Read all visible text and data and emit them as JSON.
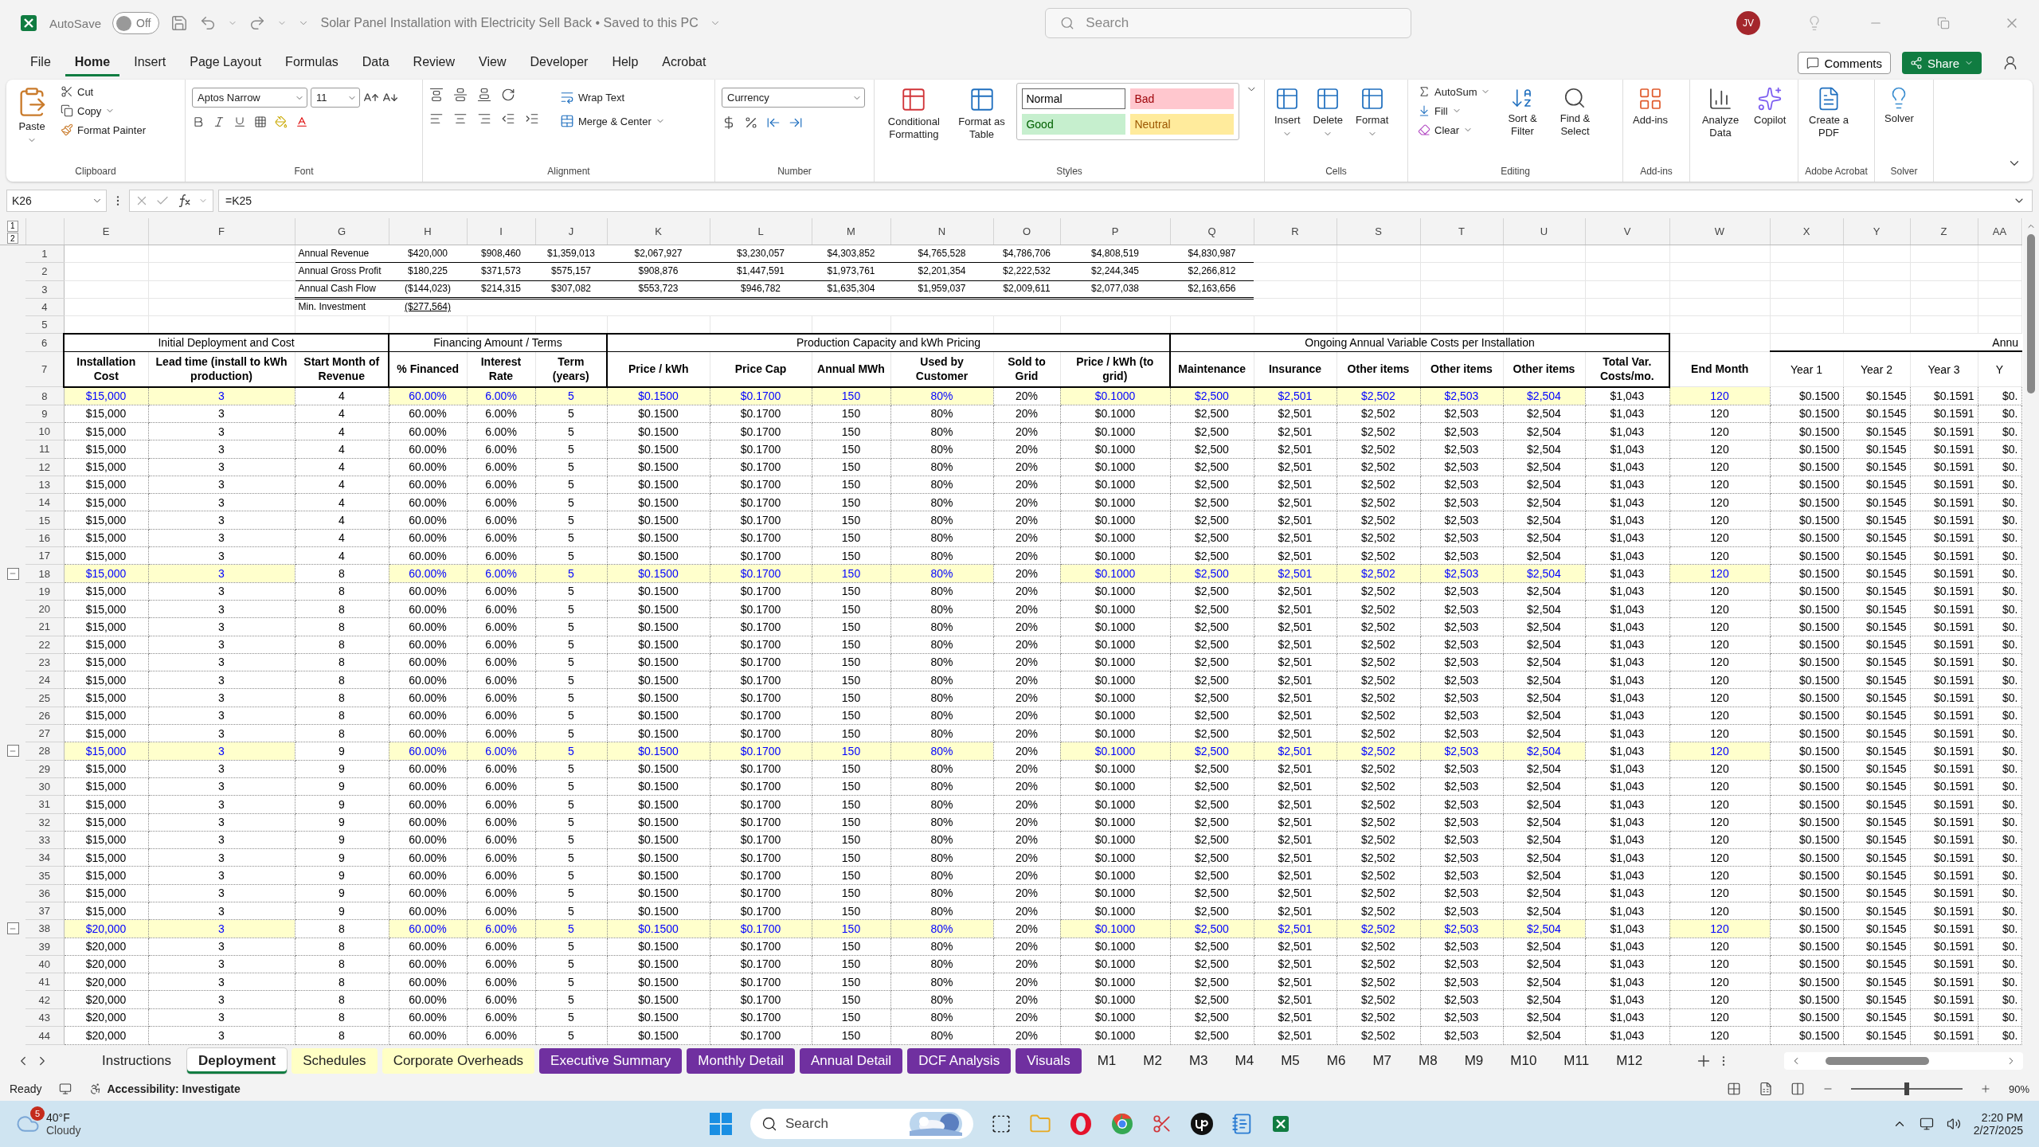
{
  "title_bar": {
    "autosave_label": "AutoSave",
    "autosave_state": "Off",
    "autosave_on": false,
    "document_title": "Solar Panel Installation with Electricity Sell Back • Saved to this PC",
    "search_placeholder": "Search",
    "avatar": "JV"
  },
  "menu_tabs": [
    {
      "label": "File",
      "selected": false
    },
    {
      "label": "Home",
      "selected": true
    },
    {
      "label": "Insert",
      "selected": false
    },
    {
      "label": "Page Layout",
      "selected": false
    },
    {
      "label": "Formulas",
      "selected": false
    },
    {
      "label": "Data",
      "selected": false
    },
    {
      "label": "Review",
      "selected": false
    },
    {
      "label": "View",
      "selected": false
    },
    {
      "label": "Developer",
      "selected": false
    },
    {
      "label": "Help",
      "selected": false
    },
    {
      "label": "Acrobat",
      "selected": false
    }
  ],
  "header_buttons": {
    "comments": "Comments",
    "share": "Share"
  },
  "ribbon": {
    "clipboard": {
      "label": "Clipboard",
      "paste": "Paste",
      "cut": "Cut",
      "copy": "Copy",
      "format_painter": "Format Painter"
    },
    "font": {
      "label": "Font",
      "name": "Aptos Narrow",
      "size": "11"
    },
    "alignment": {
      "label": "Alignment",
      "wrap": "Wrap Text",
      "merge": "Merge & Center"
    },
    "number": {
      "label": "Number",
      "format": "Currency"
    },
    "styles": {
      "label": "Styles",
      "conditional": "Conditional Formatting",
      "table": "Format as Table",
      "gallery": [
        {
          "label": "Normal",
          "color": "#ffffff"
        },
        {
          "label": "Bad",
          "color": "#ffc7ce"
        },
        {
          "label": "Good",
          "color": "#c6efce"
        },
        {
          "label": "Neutral",
          "color": "#ffeb9c"
        }
      ]
    },
    "cells": {
      "label": "Cells",
      "buttons": [
        "Insert",
        "Delete",
        "Format"
      ]
    },
    "editing": {
      "label": "Editing",
      "autosum": "AutoSum",
      "fill": "Fill",
      "clear": "Clear",
      "sort": "Sort & Filter",
      "find": "Find & Select"
    },
    "addins": {
      "label": "Add-ins",
      "button": "Add-ins"
    },
    "analysis": {
      "analyze": "Analyze Data",
      "copilot": "Copilot"
    },
    "acrobat": {
      "label": "Adobe Acrobat",
      "button": "Create a PDF"
    },
    "solver": {
      "label": "Solver",
      "button": "Solver"
    }
  },
  "formula_bar": {
    "name_box": "K26",
    "formula": "=K25"
  },
  "outline_levels": [
    "1",
    "2"
  ],
  "columns": [
    {
      "letter": "E",
      "header": "Installation Cost",
      "input": true,
      "kind": "main"
    },
    {
      "letter": "F",
      "header": "Lead time (install to kWh production)",
      "input": true,
      "kind": "main"
    },
    {
      "letter": "G",
      "header": "Start Month of Revenue",
      "input": false,
      "kind": "main"
    },
    {
      "letter": "H",
      "header": "% Financed",
      "input": true,
      "kind": "main"
    },
    {
      "letter": "I",
      "header": "Interest Rate",
      "input": true,
      "kind": "main"
    },
    {
      "letter": "J",
      "header": "Term (years)",
      "input": true,
      "kind": "main"
    },
    {
      "letter": "K",
      "header": "Price / kWh",
      "input": true,
      "kind": "main"
    },
    {
      "letter": "L",
      "header": "Price Cap",
      "input": true,
      "kind": "main"
    },
    {
      "letter": "M",
      "header": "Annual MWh",
      "input": true,
      "kind": "main"
    },
    {
      "letter": "N",
      "header": "Used by Customer",
      "input": true,
      "kind": "main"
    },
    {
      "letter": "O",
      "header": "Sold to Grid",
      "input": false,
      "kind": "main"
    },
    {
      "letter": "P",
      "header": "Price / kWh (to grid)",
      "input": true,
      "kind": "main"
    },
    {
      "letter": "Q",
      "header": "Maintenance",
      "input": true,
      "kind": "main"
    },
    {
      "letter": "R",
      "header": "Insurance",
      "input": true,
      "kind": "main"
    },
    {
      "letter": "S",
      "header": "Other items",
      "input": true,
      "kind": "main"
    },
    {
      "letter": "T",
      "header": "Other items",
      "input": true,
      "kind": "main"
    },
    {
      "letter": "U",
      "header": "Other items",
      "input": true,
      "kind": "main"
    },
    {
      "letter": "V",
      "header": "Total Var. Costs/mo.",
      "input": false,
      "kind": "main"
    },
    {
      "letter": "W",
      "header": "End Month",
      "input": true,
      "kind": "end"
    },
    {
      "letter": "X",
      "header": "Year 1",
      "input": false,
      "kind": "yearly"
    },
    {
      "letter": "Y",
      "header": "Year 2",
      "input": false,
      "kind": "yearly"
    },
    {
      "letter": "Z",
      "header": "Year 3",
      "input": false,
      "kind": "yearly"
    },
    {
      "letter": "AA",
      "header": "Y",
      "input": false,
      "kind": "yearly"
    }
  ],
  "summary_rows": [
    {
      "row": "1",
      "kind": "rule",
      "label": "Annual Revenue",
      "values": [
        "$420,000",
        "$908,460",
        "$1,359,013",
        "$2,067,927",
        "$3,230,057",
        "$4,303,852",
        "$4,765,528",
        "$4,786,706",
        "$4,808,519",
        "$4,830,987"
      ]
    },
    {
      "row": "2",
      "kind": "rule",
      "label": "Annual Gross Profit",
      "values": [
        "$180,225",
        "$371,573",
        "$575,157",
        "$908,876",
        "$1,447,591",
        "$1,973,761",
        "$2,201,354",
        "$2,222,532",
        "$2,244,345",
        "$2,266,812"
      ]
    },
    {
      "row": "3",
      "kind": "double-rule",
      "label": "Annual Cash Flow",
      "values": [
        "($144,023)",
        "$214,315",
        "$307,082",
        "$553,723",
        "$946,782",
        "$1,635,304",
        "$1,959,037",
        "$2,009,611",
        "$2,077,038",
        "$2,163,656"
      ]
    },
    {
      "row": "4",
      "kind": "underlined-value",
      "label": "Min. Investment",
      "values": [
        "($277,564)"
      ]
    }
  ],
  "blank_rows": [
    "5"
  ],
  "section_row": "6",
  "sections": [
    {
      "label": "Initial Deployment and Cost",
      "kind": "boxed"
    },
    {
      "label": "Financing Amount / Terms",
      "kind": "boxed"
    },
    {
      "label": "Production Capacity and kWh Pricing",
      "kind": "boxed"
    },
    {
      "label": "Ongoing Annual Variable Costs per Installation",
      "kind": "boxed"
    },
    {
      "label": "Annu",
      "kind": "open"
    }
  ],
  "header_row": "7",
  "rows": [
    {
      "row": "8",
      "kind": "input",
      "collapse_button": false,
      "cells": [
        "$15,000",
        "3",
        "4",
        "60.00%",
        "6.00%",
        "5",
        "$0.1500",
        "$0.1700",
        "150",
        "80%",
        "20%",
        "$0.1000",
        "$2,500",
        "$2,501",
        "$2,502",
        "$2,503",
        "$2,504",
        "$1,043",
        "120",
        "$0.1500",
        "$0.1545",
        "$0.1591",
        "$0."
      ]
    },
    {
      "row": "9",
      "kind": "formula",
      "collapse_button": false,
      "cells": [
        "$15,000",
        "3",
        "4",
        "60.00%",
        "6.00%",
        "5",
        "$0.1500",
        "$0.1700",
        "150",
        "80%",
        "20%",
        "$0.1000",
        "$2,500",
        "$2,501",
        "$2,502",
        "$2,503",
        "$2,504",
        "$1,043",
        "120",
        "$0.1500",
        "$0.1545",
        "$0.1591",
        "$0."
      ]
    },
    {
      "row": "10",
      "kind": "formula",
      "collapse_button": false,
      "cells": [
        "$15,000",
        "3",
        "4",
        "60.00%",
        "6.00%",
        "5",
        "$0.1500",
        "$0.1700",
        "150",
        "80%",
        "20%",
        "$0.1000",
        "$2,500",
        "$2,501",
        "$2,502",
        "$2,503",
        "$2,504",
        "$1,043",
        "120",
        "$0.1500",
        "$0.1545",
        "$0.1591",
        "$0."
      ]
    },
    {
      "row": "11",
      "kind": "formula",
      "collapse_button": false,
      "cells": [
        "$15,000",
        "3",
        "4",
        "60.00%",
        "6.00%",
        "5",
        "$0.1500",
        "$0.1700",
        "150",
        "80%",
        "20%",
        "$0.1000",
        "$2,500",
        "$2,501",
        "$2,502",
        "$2,503",
        "$2,504",
        "$1,043",
        "120",
        "$0.1500",
        "$0.1545",
        "$0.1591",
        "$0."
      ]
    },
    {
      "row": "12",
      "kind": "formula",
      "collapse_button": false,
      "cells": [
        "$15,000",
        "3",
        "4",
        "60.00%",
        "6.00%",
        "5",
        "$0.1500",
        "$0.1700",
        "150",
        "80%",
        "20%",
        "$0.1000",
        "$2,500",
        "$2,501",
        "$2,502",
        "$2,503",
        "$2,504",
        "$1,043",
        "120",
        "$0.1500",
        "$0.1545",
        "$0.1591",
        "$0."
      ]
    },
    {
      "row": "13",
      "kind": "formula",
      "collapse_button": false,
      "cells": [
        "$15,000",
        "3",
        "4",
        "60.00%",
        "6.00%",
        "5",
        "$0.1500",
        "$0.1700",
        "150",
        "80%",
        "20%",
        "$0.1000",
        "$2,500",
        "$2,501",
        "$2,502",
        "$2,503",
        "$2,504",
        "$1,043",
        "120",
        "$0.1500",
        "$0.1545",
        "$0.1591",
        "$0."
      ]
    },
    {
      "row": "14",
      "kind": "formula",
      "collapse_button": false,
      "cells": [
        "$15,000",
        "3",
        "4",
        "60.00%",
        "6.00%",
        "5",
        "$0.1500",
        "$0.1700",
        "150",
        "80%",
        "20%",
        "$0.1000",
        "$2,500",
        "$2,501",
        "$2,502",
        "$2,503",
        "$2,504",
        "$1,043",
        "120",
        "$0.1500",
        "$0.1545",
        "$0.1591",
        "$0."
      ]
    },
    {
      "row": "15",
      "kind": "formula",
      "collapse_button": false,
      "cells": [
        "$15,000",
        "3",
        "4",
        "60.00%",
        "6.00%",
        "5",
        "$0.1500",
        "$0.1700",
        "150",
        "80%",
        "20%",
        "$0.1000",
        "$2,500",
        "$2,501",
        "$2,502",
        "$2,503",
        "$2,504",
        "$1,043",
        "120",
        "$0.1500",
        "$0.1545",
        "$0.1591",
        "$0."
      ]
    },
    {
      "row": "16",
      "kind": "formula",
      "collapse_button": false,
      "cells": [
        "$15,000",
        "3",
        "4",
        "60.00%",
        "6.00%",
        "5",
        "$0.1500",
        "$0.1700",
        "150",
        "80%",
        "20%",
        "$0.1000",
        "$2,500",
        "$2,501",
        "$2,502",
        "$2,503",
        "$2,504",
        "$1,043",
        "120",
        "$0.1500",
        "$0.1545",
        "$0.1591",
        "$0."
      ]
    },
    {
      "row": "17",
      "kind": "formula",
      "collapse_button": false,
      "cells": [
        "$15,000",
        "3",
        "4",
        "60.00%",
        "6.00%",
        "5",
        "$0.1500",
        "$0.1700",
        "150",
        "80%",
        "20%",
        "$0.1000",
        "$2,500",
        "$2,501",
        "$2,502",
        "$2,503",
        "$2,504",
        "$1,043",
        "120",
        "$0.1500",
        "$0.1545",
        "$0.1591",
        "$0."
      ]
    },
    {
      "row": "18",
      "kind": "input",
      "collapse_button": true,
      "cells": [
        "$15,000",
        "3",
        "8",
        "60.00%",
        "6.00%",
        "5",
        "$0.1500",
        "$0.1700",
        "150",
        "80%",
        "20%",
        "$0.1000",
        "$2,500",
        "$2,501",
        "$2,502",
        "$2,503",
        "$2,504",
        "$1,043",
        "120",
        "$0.1500",
        "$0.1545",
        "$0.1591",
        "$0."
      ]
    },
    {
      "row": "19",
      "kind": "formula",
      "collapse_button": false,
      "cells": [
        "$15,000",
        "3",
        "8",
        "60.00%",
        "6.00%",
        "5",
        "$0.1500",
        "$0.1700",
        "150",
        "80%",
        "20%",
        "$0.1000",
        "$2,500",
        "$2,501",
        "$2,502",
        "$2,503",
        "$2,504",
        "$1,043",
        "120",
        "$0.1500",
        "$0.1545",
        "$0.1591",
        "$0."
      ]
    },
    {
      "row": "20",
      "kind": "formula",
      "collapse_button": false,
      "cells": [
        "$15,000",
        "3",
        "8",
        "60.00%",
        "6.00%",
        "5",
        "$0.1500",
        "$0.1700",
        "150",
        "80%",
        "20%",
        "$0.1000",
        "$2,500",
        "$2,501",
        "$2,502",
        "$2,503",
        "$2,504",
        "$1,043",
        "120",
        "$0.1500",
        "$0.1545",
        "$0.1591",
        "$0."
      ]
    },
    {
      "row": "21",
      "kind": "formula",
      "collapse_button": false,
      "cells": [
        "$15,000",
        "3",
        "8",
        "60.00%",
        "6.00%",
        "5",
        "$0.1500",
        "$0.1700",
        "150",
        "80%",
        "20%",
        "$0.1000",
        "$2,500",
        "$2,501",
        "$2,502",
        "$2,503",
        "$2,504",
        "$1,043",
        "120",
        "$0.1500",
        "$0.1545",
        "$0.1591",
        "$0."
      ]
    },
    {
      "row": "22",
      "kind": "formula",
      "collapse_button": false,
      "cells": [
        "$15,000",
        "3",
        "8",
        "60.00%",
        "6.00%",
        "5",
        "$0.1500",
        "$0.1700",
        "150",
        "80%",
        "20%",
        "$0.1000",
        "$2,500",
        "$2,501",
        "$2,502",
        "$2,503",
        "$2,504",
        "$1,043",
        "120",
        "$0.1500",
        "$0.1545",
        "$0.1591",
        "$0."
      ]
    },
    {
      "row": "23",
      "kind": "formula",
      "collapse_button": false,
      "cells": [
        "$15,000",
        "3",
        "8",
        "60.00%",
        "6.00%",
        "5",
        "$0.1500",
        "$0.1700",
        "150",
        "80%",
        "20%",
        "$0.1000",
        "$2,500",
        "$2,501",
        "$2,502",
        "$2,503",
        "$2,504",
        "$1,043",
        "120",
        "$0.1500",
        "$0.1545",
        "$0.1591",
        "$0."
      ]
    },
    {
      "row": "24",
      "kind": "formula",
      "collapse_button": false,
      "cells": [
        "$15,000",
        "3",
        "8",
        "60.00%",
        "6.00%",
        "5",
        "$0.1500",
        "$0.1700",
        "150",
        "80%",
        "20%",
        "$0.1000",
        "$2,500",
        "$2,501",
        "$2,502",
        "$2,503",
        "$2,504",
        "$1,043",
        "120",
        "$0.1500",
        "$0.1545",
        "$0.1591",
        "$0."
      ]
    },
    {
      "row": "25",
      "kind": "formula",
      "collapse_button": false,
      "cells": [
        "$15,000",
        "3",
        "8",
        "60.00%",
        "6.00%",
        "5",
        "$0.1500",
        "$0.1700",
        "150",
        "80%",
        "20%",
        "$0.1000",
        "$2,500",
        "$2,501",
        "$2,502",
        "$2,503",
        "$2,504",
        "$1,043",
        "120",
        "$0.1500",
        "$0.1545",
        "$0.1591",
        "$0."
      ]
    },
    {
      "row": "26",
      "kind": "formula",
      "collapse_button": false,
      "cells": [
        "$15,000",
        "3",
        "8",
        "60.00%",
        "6.00%",
        "5",
        "$0.1500",
        "$0.1700",
        "150",
        "80%",
        "20%",
        "$0.1000",
        "$2,500",
        "$2,501",
        "$2,502",
        "$2,503",
        "$2,504",
        "$1,043",
        "120",
        "$0.1500",
        "$0.1545",
        "$0.1591",
        "$0."
      ]
    },
    {
      "row": "27",
      "kind": "formula",
      "collapse_button": false,
      "cells": [
        "$15,000",
        "3",
        "8",
        "60.00%",
        "6.00%",
        "5",
        "$0.1500",
        "$0.1700",
        "150",
        "80%",
        "20%",
        "$0.1000",
        "$2,500",
        "$2,501",
        "$2,502",
        "$2,503",
        "$2,504",
        "$1,043",
        "120",
        "$0.1500",
        "$0.1545",
        "$0.1591",
        "$0."
      ]
    },
    {
      "row": "28",
      "kind": "input",
      "collapse_button": true,
      "cells": [
        "$15,000",
        "3",
        "9",
        "60.00%",
        "6.00%",
        "5",
        "$0.1500",
        "$0.1700",
        "150",
        "80%",
        "20%",
        "$0.1000",
        "$2,500",
        "$2,501",
        "$2,502",
        "$2,503",
        "$2,504",
        "$1,043",
        "120",
        "$0.1500",
        "$0.1545",
        "$0.1591",
        "$0."
      ]
    },
    {
      "row": "29",
      "kind": "formula",
      "collapse_button": false,
      "cells": [
        "$15,000",
        "3",
        "9",
        "60.00%",
        "6.00%",
        "5",
        "$0.1500",
        "$0.1700",
        "150",
        "80%",
        "20%",
        "$0.1000",
        "$2,500",
        "$2,501",
        "$2,502",
        "$2,503",
        "$2,504",
        "$1,043",
        "120",
        "$0.1500",
        "$0.1545",
        "$0.1591",
        "$0."
      ]
    },
    {
      "row": "30",
      "kind": "formula",
      "collapse_button": false,
      "cells": [
        "$15,000",
        "3",
        "9",
        "60.00%",
        "6.00%",
        "5",
        "$0.1500",
        "$0.1700",
        "150",
        "80%",
        "20%",
        "$0.1000",
        "$2,500",
        "$2,501",
        "$2,502",
        "$2,503",
        "$2,504",
        "$1,043",
        "120",
        "$0.1500",
        "$0.1545",
        "$0.1591",
        "$0."
      ]
    },
    {
      "row": "31",
      "kind": "formula",
      "collapse_button": false,
      "cells": [
        "$15,000",
        "3",
        "9",
        "60.00%",
        "6.00%",
        "5",
        "$0.1500",
        "$0.1700",
        "150",
        "80%",
        "20%",
        "$0.1000",
        "$2,500",
        "$2,501",
        "$2,502",
        "$2,503",
        "$2,504",
        "$1,043",
        "120",
        "$0.1500",
        "$0.1545",
        "$0.1591",
        "$0."
      ]
    },
    {
      "row": "32",
      "kind": "formula",
      "collapse_button": false,
      "cells": [
        "$15,000",
        "3",
        "9",
        "60.00%",
        "6.00%",
        "5",
        "$0.1500",
        "$0.1700",
        "150",
        "80%",
        "20%",
        "$0.1000",
        "$2,500",
        "$2,501",
        "$2,502",
        "$2,503",
        "$2,504",
        "$1,043",
        "120",
        "$0.1500",
        "$0.1545",
        "$0.1591",
        "$0."
      ]
    },
    {
      "row": "33",
      "kind": "formula",
      "collapse_button": false,
      "cells": [
        "$15,000",
        "3",
        "9",
        "60.00%",
        "6.00%",
        "5",
        "$0.1500",
        "$0.1700",
        "150",
        "80%",
        "20%",
        "$0.1000",
        "$2,500",
        "$2,501",
        "$2,502",
        "$2,503",
        "$2,504",
        "$1,043",
        "120",
        "$0.1500",
        "$0.1545",
        "$0.1591",
        "$0."
      ]
    },
    {
      "row": "34",
      "kind": "formula",
      "collapse_button": false,
      "cells": [
        "$15,000",
        "3",
        "9",
        "60.00%",
        "6.00%",
        "5",
        "$0.1500",
        "$0.1700",
        "150",
        "80%",
        "20%",
        "$0.1000",
        "$2,500",
        "$2,501",
        "$2,502",
        "$2,503",
        "$2,504",
        "$1,043",
        "120",
        "$0.1500",
        "$0.1545",
        "$0.1591",
        "$0."
      ]
    },
    {
      "row": "35",
      "kind": "formula",
      "collapse_button": false,
      "cells": [
        "$15,000",
        "3",
        "9",
        "60.00%",
        "6.00%",
        "5",
        "$0.1500",
        "$0.1700",
        "150",
        "80%",
        "20%",
        "$0.1000",
        "$2,500",
        "$2,501",
        "$2,502",
        "$2,503",
        "$2,504",
        "$1,043",
        "120",
        "$0.1500",
        "$0.1545",
        "$0.1591",
        "$0."
      ]
    },
    {
      "row": "36",
      "kind": "formula",
      "collapse_button": false,
      "cells": [
        "$15,000",
        "3",
        "9",
        "60.00%",
        "6.00%",
        "5",
        "$0.1500",
        "$0.1700",
        "150",
        "80%",
        "20%",
        "$0.1000",
        "$2,500",
        "$2,501",
        "$2,502",
        "$2,503",
        "$2,504",
        "$1,043",
        "120",
        "$0.1500",
        "$0.1545",
        "$0.1591",
        "$0."
      ]
    },
    {
      "row": "37",
      "kind": "formula",
      "collapse_button": false,
      "cells": [
        "$15,000",
        "3",
        "9",
        "60.00%",
        "6.00%",
        "5",
        "$0.1500",
        "$0.1700",
        "150",
        "80%",
        "20%",
        "$0.1000",
        "$2,500",
        "$2,501",
        "$2,502",
        "$2,503",
        "$2,504",
        "$1,043",
        "120",
        "$0.1500",
        "$0.1545",
        "$0.1591",
        "$0."
      ]
    },
    {
      "row": "38",
      "kind": "input",
      "collapse_button": true,
      "cells": [
        "$20,000",
        "3",
        "8",
        "60.00%",
        "6.00%",
        "5",
        "$0.1500",
        "$0.1700",
        "150",
        "80%",
        "20%",
        "$0.1000",
        "$2,500",
        "$2,501",
        "$2,502",
        "$2,503",
        "$2,504",
        "$1,043",
        "120",
        "$0.1500",
        "$0.1545",
        "$0.1591",
        "$0."
      ]
    },
    {
      "row": "39",
      "kind": "formula",
      "collapse_button": false,
      "cells": [
        "$20,000",
        "3",
        "8",
        "60.00%",
        "6.00%",
        "5",
        "$0.1500",
        "$0.1700",
        "150",
        "80%",
        "20%",
        "$0.1000",
        "$2,500",
        "$2,501",
        "$2,502",
        "$2,503",
        "$2,504",
        "$1,043",
        "120",
        "$0.1500",
        "$0.1545",
        "$0.1591",
        "$0."
      ]
    },
    {
      "row": "40",
      "kind": "formula",
      "collapse_button": false,
      "cells": [
        "$20,000",
        "3",
        "8",
        "60.00%",
        "6.00%",
        "5",
        "$0.1500",
        "$0.1700",
        "150",
        "80%",
        "20%",
        "$0.1000",
        "$2,500",
        "$2,501",
        "$2,502",
        "$2,503",
        "$2,504",
        "$1,043",
        "120",
        "$0.1500",
        "$0.1545",
        "$0.1591",
        "$0."
      ]
    },
    {
      "row": "41",
      "kind": "formula",
      "collapse_button": false,
      "cells": [
        "$20,000",
        "3",
        "8",
        "60.00%",
        "6.00%",
        "5",
        "$0.1500",
        "$0.1700",
        "150",
        "80%",
        "20%",
        "$0.1000",
        "$2,500",
        "$2,501",
        "$2,502",
        "$2,503",
        "$2,504",
        "$1,043",
        "120",
        "$0.1500",
        "$0.1545",
        "$0.1591",
        "$0."
      ]
    },
    {
      "row": "42",
      "kind": "formula",
      "collapse_button": false,
      "cells": [
        "$20,000",
        "3",
        "8",
        "60.00%",
        "6.00%",
        "5",
        "$0.1500",
        "$0.1700",
        "150",
        "80%",
        "20%",
        "$0.1000",
        "$2,500",
        "$2,501",
        "$2,502",
        "$2,503",
        "$2,504",
        "$1,043",
        "120",
        "$0.1500",
        "$0.1545",
        "$0.1591",
        "$0."
      ]
    },
    {
      "row": "43",
      "kind": "formula",
      "collapse_button": false,
      "cells": [
        "$20,000",
        "3",
        "8",
        "60.00%",
        "6.00%",
        "5",
        "$0.1500",
        "$0.1700",
        "150",
        "80%",
        "20%",
        "$0.1000",
        "$2,500",
        "$2,501",
        "$2,502",
        "$2,503",
        "$2,504",
        "$1,043",
        "120",
        "$0.1500",
        "$0.1545",
        "$0.1591",
        "$0."
      ]
    },
    {
      "row": "44",
      "kind": "formula",
      "collapse_button": false,
      "cells": [
        "$20,000",
        "3",
        "8",
        "60.00%",
        "6.00%",
        "5",
        "$0.1500",
        "$0.1700",
        "150",
        "80%",
        "20%",
        "$0.1000",
        "$2,500",
        "$2,501",
        "$2,502",
        "$2,503",
        "$2,504",
        "$1,043",
        "120",
        "$0.1500",
        "$0.1545",
        "$0.1591",
        "$0."
      ]
    }
  ],
  "sheet_tabs": [
    {
      "label": "Instructions",
      "selected": false
    },
    {
      "label": "Deployment",
      "selected": true
    },
    {
      "label": "Schedules",
      "selected": false,
      "color": "#ffffc5"
    },
    {
      "label": "Corporate Overheads",
      "selected": false,
      "color": "#ffffc5"
    },
    {
      "label": "Executive Summary",
      "selected": false,
      "color": "#7030a0"
    },
    {
      "label": "Monthly Detail",
      "selected": false,
      "color": "#7030a0"
    },
    {
      "label": "Annual Detail",
      "selected": false,
      "color": "#7030a0"
    },
    {
      "label": "DCF Analysis",
      "selected": false,
      "color": "#7030a0"
    },
    {
      "label": "Visuals",
      "selected": false,
      "color": "#7030a0"
    },
    {
      "label": "M1",
      "selected": false
    },
    {
      "label": "M2",
      "selected": false
    },
    {
      "label": "M3",
      "selected": false
    },
    {
      "label": "M4",
      "selected": false
    },
    {
      "label": "M5",
      "selected": false
    },
    {
      "label": "M6",
      "selected": false
    },
    {
      "label": "M7",
      "selected": false
    },
    {
      "label": "M8",
      "selected": false
    },
    {
      "label": "M9",
      "selected": false
    },
    {
      "label": "M10",
      "selected": false
    },
    {
      "label": "M11",
      "selected": false
    },
    {
      "label": "M12",
      "selected": false
    }
  ],
  "status_bar": {
    "ready": "Ready",
    "accessibility": "Accessibility: Investigate",
    "zoom": {
      "reading": "90%",
      "level": 0.5
    }
  },
  "taskbar": {
    "weather": {
      "badge": "5",
      "temperature": "40°F",
      "condition": "Cloudy"
    },
    "search_placeholder": "Search",
    "time": "2:20 PM",
    "date": "2/27/2025"
  }
}
